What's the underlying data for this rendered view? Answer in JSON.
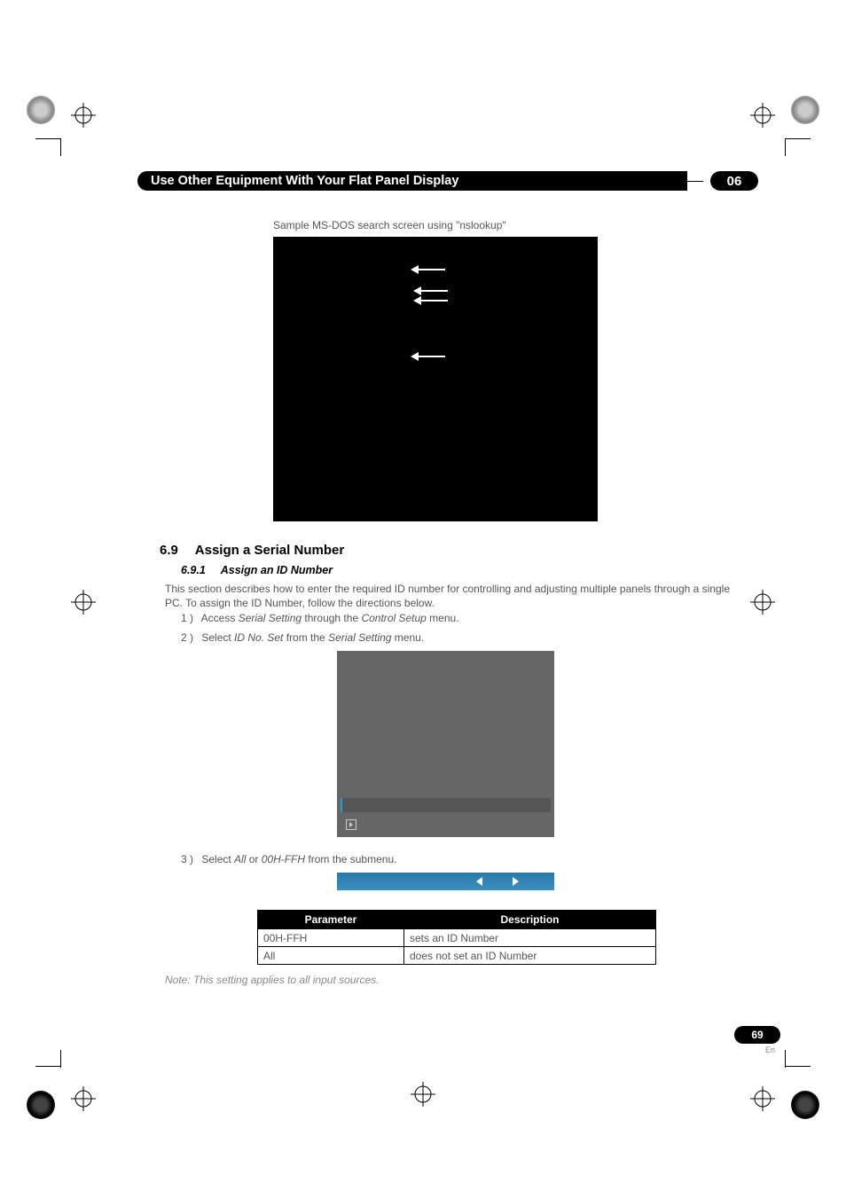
{
  "header": {
    "title": "Use Other Equipment With Your Flat Panel Display",
    "chapter": "06"
  },
  "caption1": "Sample MS-DOS search screen using \"nslookup\"",
  "section": {
    "num": "6.9",
    "title": "Assign a Serial Number"
  },
  "subsection": {
    "num": "6.9.1",
    "title": "Assign an ID Number"
  },
  "intro": "This section describes how to enter the required ID number for controlling and adjusting multiple panels through a single PC. To assign the ID Number, follow the directions below.",
  "steps": {
    "s1": {
      "n": "1 )",
      "pre": "Access ",
      "i1": "Serial Setting",
      "mid": " through the ",
      "i2": "Control Setup",
      "post": " menu."
    },
    "s2": {
      "n": "2 )",
      "pre": "Select ",
      "i1": "ID No. Set ",
      "mid": " from the ",
      "i2": "Serial Setting",
      "post": " menu."
    },
    "s3": {
      "n": "3 )",
      "pre": "Select ",
      "i1": "All",
      "mid": " or ",
      "i2": "00H-FFH",
      "post": " from the submenu."
    }
  },
  "table": {
    "h1": "Parameter",
    "h2": "Description",
    "rows": [
      {
        "p": "00H-FFH",
        "d": "sets an ID Number"
      },
      {
        "p": "All",
        "d": "does not set an ID Number"
      }
    ]
  },
  "note": "Note: This setting applies to all input sources.",
  "page": {
    "num": "69",
    "lang": "En"
  }
}
